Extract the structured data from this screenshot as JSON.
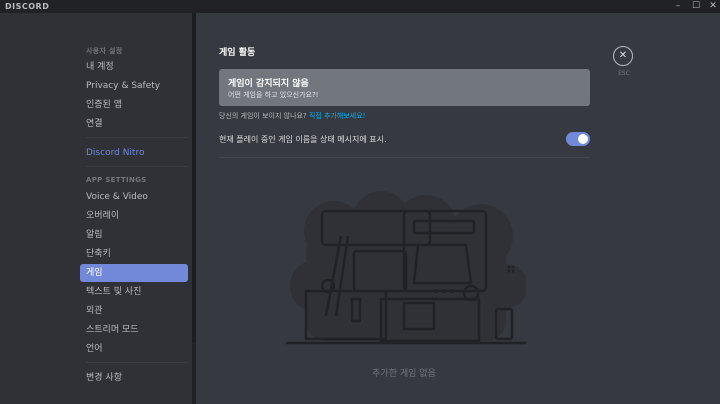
{
  "titlebar": {
    "brand": "DISCORD",
    "minimize": "–",
    "maximize": "☐",
    "close": "✕"
  },
  "sidebar": {
    "user_settings_header": "사용자 설정",
    "user_items": [
      "내 계정",
      "Privacy & Safety",
      "인증된 앱",
      "연결"
    ],
    "nitro": "Discord Nitro",
    "app_settings_header": "APP SETTINGS",
    "app_items": [
      "Voice & Video",
      "오버레이",
      "알림",
      "단축키",
      "게임",
      "텍스트 및 사진",
      "외관",
      "스트리머 모드",
      "언어"
    ],
    "active_item": "게임",
    "changelog": "변경 사항"
  },
  "main": {
    "title": "게임 활동",
    "game_box": {
      "title": "게임이 감지되지 않음",
      "subtitle": "어떤 게임을 하고 있으신가요?!"
    },
    "hint_prefix": "당신의 게임이 보이지 않나요?",
    "hint_link": "직접 추가해보세요!",
    "status_label": "현재 플레이 중인 게임 이름을 상태 메시지에 표시.",
    "toggle_on": true,
    "esc_label": "ESC",
    "no_games": "추가한 게임 없음"
  },
  "colors": {
    "accent": "#7289da",
    "link": "#00b0f4",
    "bg": "#36393f",
    "sidebar": "#2f3136"
  }
}
